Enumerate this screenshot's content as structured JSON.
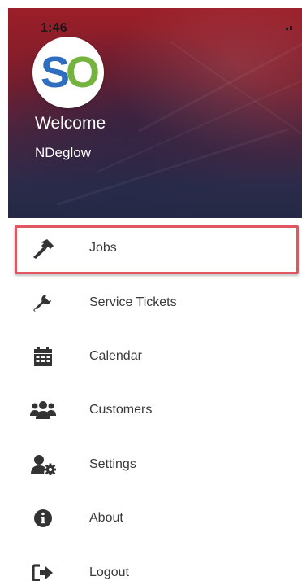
{
  "status_bar": {
    "time": "1:46"
  },
  "header": {
    "avatar": {
      "letters_first": "S",
      "letters_second": "O"
    },
    "welcome_text": "Welcome",
    "username": "NDeglow"
  },
  "menu": {
    "items": [
      {
        "label": "Jobs",
        "icon": "hammer-icon",
        "selected": true
      },
      {
        "label": "Service Tickets",
        "icon": "wrench-icon",
        "selected": false
      },
      {
        "label": "Calendar",
        "icon": "calendar-icon",
        "selected": false
      },
      {
        "label": "Customers",
        "icon": "users-icon",
        "selected": false
      },
      {
        "label": "Settings",
        "icon": "user-cog-icon",
        "selected": false
      },
      {
        "label": "About",
        "icon": "info-circle-icon",
        "selected": false
      },
      {
        "label": "Logout",
        "icon": "sign-out-icon",
        "selected": false
      }
    ]
  },
  "colors": {
    "highlight_border": "#e0585f",
    "icon": "#333333",
    "label": "#3a3a3a",
    "avatar_s": "#2f6dbf",
    "avatar_o": "#74b43e"
  }
}
